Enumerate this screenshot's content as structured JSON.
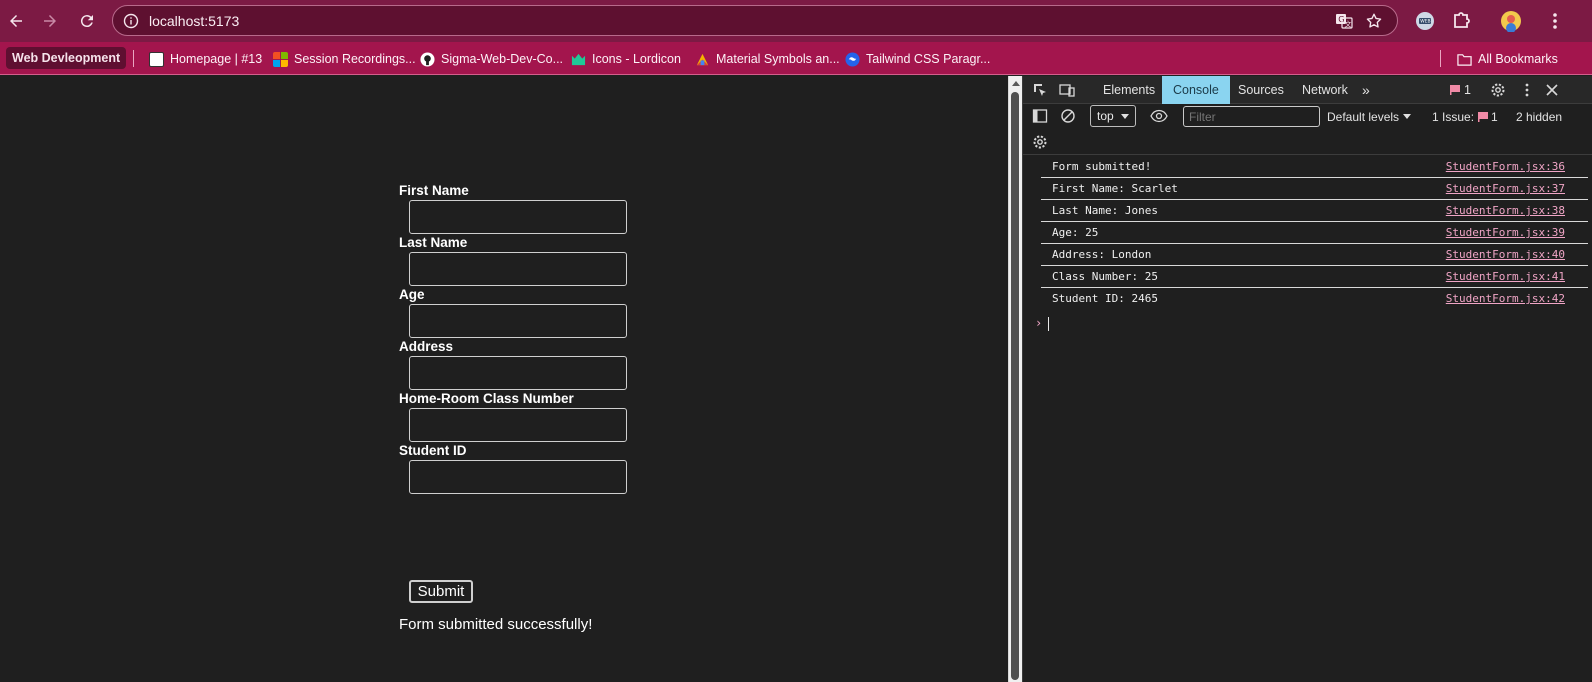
{
  "browser": {
    "url": "localhost:5173",
    "bookmarks": [
      {
        "label": "Web Devleopment",
        "icon": "folder-pill",
        "color": "#5f0f31"
      },
      {
        "label": "Homepage | #13",
        "icon": "homepage-favicon",
        "color": "#ffffff"
      },
      {
        "label": "Session Recordings...",
        "icon": "microsoft-favicon",
        "color": "#f25022"
      },
      {
        "label": "Sigma-Web-Dev-Co...",
        "icon": "github-favicon",
        "color": "#ffffff"
      },
      {
        "label": "Icons - Lordicon",
        "icon": "lordicon-favicon",
        "color": "#20c997"
      },
      {
        "label": "Material Symbols an...",
        "icon": "material-favicon",
        "color": "#4285f4"
      },
      {
        "label": "Tailwind CSS Paragr...",
        "icon": "tailwind-favicon",
        "color": "#2563eb"
      }
    ],
    "all_bookmarks_label": "All Bookmarks"
  },
  "form": {
    "fields": [
      {
        "label": "First Name",
        "value": ""
      },
      {
        "label": "Last Name",
        "value": ""
      },
      {
        "label": "Age",
        "value": ""
      },
      {
        "label": "Address",
        "value": ""
      },
      {
        "label": "Home-Room Class Number",
        "value": ""
      },
      {
        "label": "Student ID",
        "value": ""
      }
    ],
    "submit_label": "Submit",
    "success_message": "Form submitted successfully!"
  },
  "devtools": {
    "tabs": [
      "Elements",
      "Console",
      "Sources",
      "Network"
    ],
    "active_tab": "Console",
    "issues_badge": "1",
    "context": "top",
    "filter_placeholder": "Filter",
    "levels_label": "Default levels",
    "issues_label": "1 Issue:",
    "issues_count": "1",
    "hidden_label": "2 hidden",
    "logs": [
      {
        "message": "Form submitted!",
        "source": "StudentForm.jsx:36"
      },
      {
        "message": "First Name: Scarlet",
        "source": "StudentForm.jsx:37"
      },
      {
        "message": "Last Name: Jones",
        "source": "StudentForm.jsx:38"
      },
      {
        "message": "Age: 25",
        "source": "StudentForm.jsx:39"
      },
      {
        "message": "Address: London",
        "source": "StudentForm.jsx:40"
      },
      {
        "message": "Class Number: 25",
        "source": "StudentForm.jsx:41"
      },
      {
        "message": "Student ID: 2465",
        "source": "StudentForm.jsx:42"
      }
    ],
    "prompt": "›"
  }
}
